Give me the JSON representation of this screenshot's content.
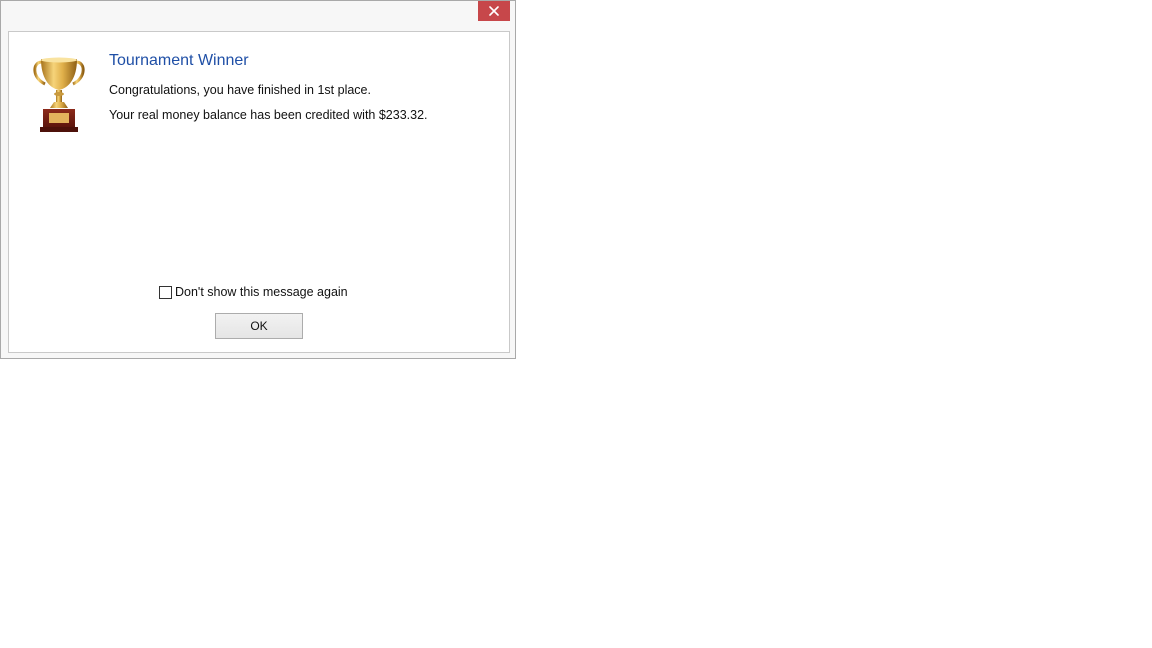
{
  "dialog": {
    "title": "Tournament Winner",
    "message_line1": "Congratulations, you have finished in 1st place.",
    "message_line2": "Your real money balance has been credited with $233.32.",
    "checkbox_label": "Don't show this message again",
    "checkbox_checked": false,
    "ok_label": "OK",
    "icon": "trophy-icon",
    "close_icon": "close-icon"
  },
  "colors": {
    "title": "#1f4fa6",
    "close_button": "#c7474a",
    "trophy_gold": "#d9a53a",
    "trophy_base": "#7a1f14"
  }
}
